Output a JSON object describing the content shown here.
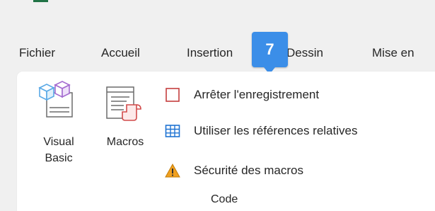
{
  "ribbon_tabs": [
    {
      "label": "Fichier"
    },
    {
      "label": "Accueil"
    },
    {
      "label": "Insertion"
    },
    {
      "label": "Dessin"
    },
    {
      "label": "Mise en"
    }
  ],
  "keytip": {
    "label": "7"
  },
  "code_group": {
    "visual_basic": {
      "label_line1": "Visual",
      "label_line2": "Basic"
    },
    "macros": {
      "label": "Macros"
    },
    "stop_recording": {
      "label": "Arrêter l'enregistrement"
    },
    "relative_references": {
      "label": "Utiliser les références relatives"
    },
    "macro_security": {
      "label": "Sécurité des macros"
    },
    "group_label": "Code"
  },
  "colors": {
    "accent_green": "#217346",
    "keytip_blue": "#3b8ee8",
    "stop_red": "#c43e3e",
    "table_blue": "#1e73d2",
    "warning_orange": "#f0a020"
  }
}
